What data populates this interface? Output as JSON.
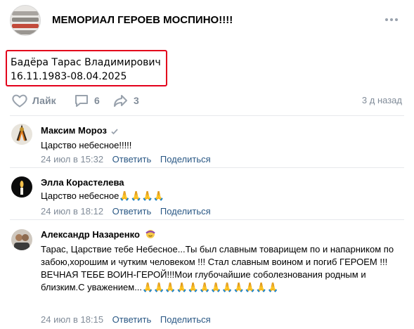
{
  "group": {
    "title": "МЕМОРИАЛ ГЕРОЕВ МОСПИНО!!!!"
  },
  "post": {
    "name": "Бадёра Тарас Владимирович",
    "dates": "16.11.1983-08.04.2025"
  },
  "actions": {
    "like_label": "Лайк",
    "comments_count": "6",
    "shares_count": "3",
    "time_ago": "3 д назад"
  },
  "comments": [
    {
      "author": "Максим Мороз",
      "text": "Царство небесное!!!!!",
      "time": "24 июл в 15:32",
      "reply_label": "Ответить",
      "share_label": "Поделиться"
    },
    {
      "author": "Элла Корастелева",
      "text": "Царство небесное🙏🙏🙏🙏",
      "time": "24 июл в 18:12",
      "reply_label": "Ответить",
      "share_label": "Поделиться"
    },
    {
      "author": "Александр Назаренко",
      "text": "Тарас, Царствие тебе Небесное...Ты был славным товарищем по и напарником по забою,хорошим и чутким человеком !!! Стал славным воином и погиб ГЕРОЕМ !!!ВЕЧНАЯ ТЕБЕ ВОИН-ГЕРОЙ!!!Мои глубочайшие соболезнования родным и близким.С уважением...🙏🙏🙏🙏🙏🙏🙏🙏🙏🙏🙏🙏",
      "time": "24 июл в 18:15",
      "reply_label": "Ответить",
      "share_label": "Поделиться"
    }
  ],
  "colors": {
    "accent_link": "#2a5885",
    "muted": "#818c99",
    "highlight_border": "#e3001b"
  },
  "icons": {
    "like": "heart-icon",
    "comments": "comment-bubble-icon",
    "share": "share-arrow-icon",
    "more": "more-dots-icon",
    "verified": "checkmark-icon",
    "status_emoji": "smile-emoji-icon"
  }
}
